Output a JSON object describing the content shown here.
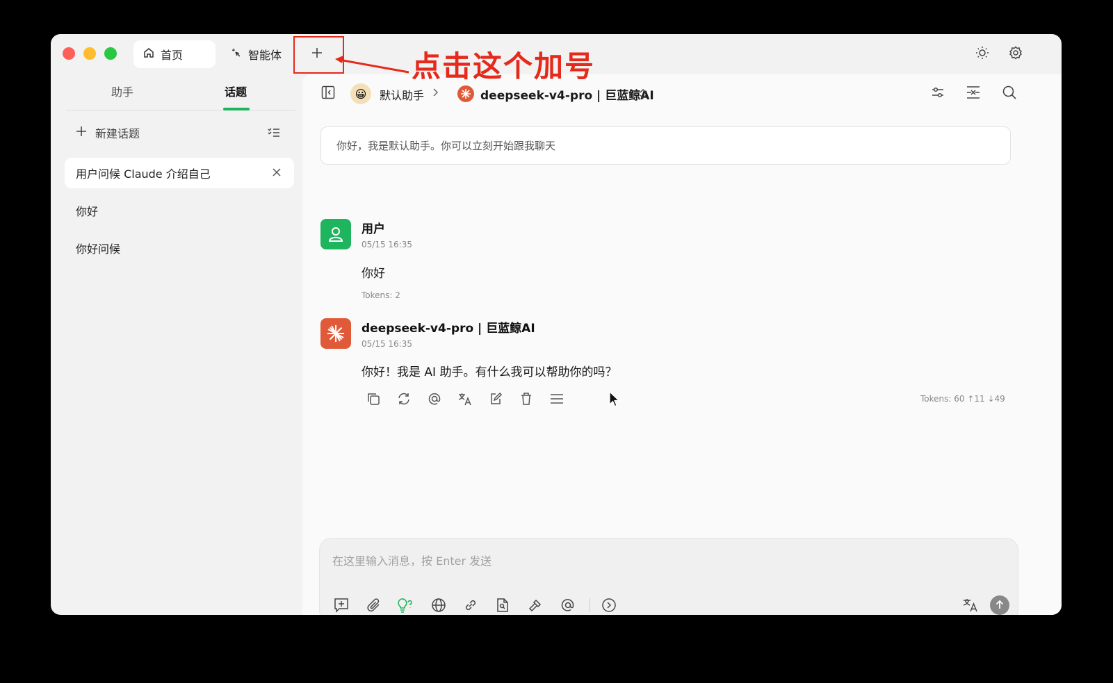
{
  "window": {
    "tabs": [
      {
        "label": "首页",
        "icon": "home-icon"
      },
      {
        "label": "智能体",
        "icon": "sparkle-icon"
      }
    ]
  },
  "sidebar": {
    "tabs": [
      {
        "label": "助手"
      },
      {
        "label": "话题"
      }
    ],
    "active_tab": "话题",
    "new_topic_label": "新建话题",
    "topics": [
      {
        "label": "用户问候 Claude 介绍自己"
      },
      {
        "label": "你好"
      },
      {
        "label": "你好问候"
      }
    ]
  },
  "header": {
    "assistant_emoji": "😀",
    "assistant_name": "默认助手",
    "model_name": "deepseek-v4-pro | 巨蓝鲸AI"
  },
  "chat": {
    "greeting": "你好，我是默认助手。你可以立刻开始跟我聊天",
    "messages": [
      {
        "sender": "用户",
        "time": "05/15 16:35",
        "text": "你好",
        "tokens": "Tokens: 2"
      },
      {
        "sender": "deepseek-v4-pro | 巨蓝鲸AI",
        "time": "05/15 16:35",
        "text": "你好！我是 AI 助手。有什么我可以帮助你的吗？",
        "tokens": "Tokens: 60  ↑11  ↓49"
      }
    ]
  },
  "input": {
    "placeholder": "在这里输入消息，按 Enter 发送",
    "value": ""
  },
  "annotation": {
    "text": "点击这个加号"
  },
  "colors": {
    "accent_green": "#1fb45e",
    "annotation_red": "#e5291b",
    "model_orange": "#e05a3a"
  }
}
